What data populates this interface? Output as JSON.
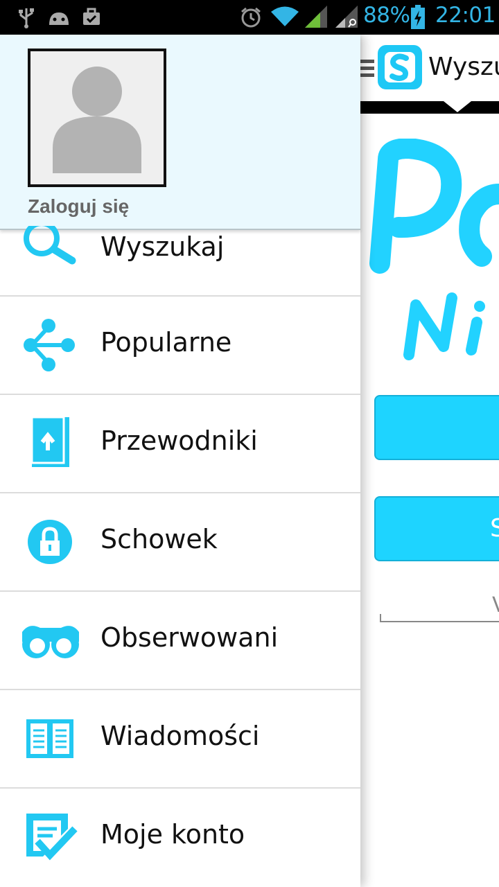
{
  "status_bar": {
    "battery": "88%",
    "time": "22:01"
  },
  "drawer": {
    "login_label": "Zaloguj się",
    "items": [
      {
        "label": "Wyszukaj",
        "icon": "search-icon"
      },
      {
        "label": "Popularne",
        "icon": "share-icon"
      },
      {
        "label": "Przewodniki",
        "icon": "book-icon"
      },
      {
        "label": "Schowek",
        "icon": "lock-icon"
      },
      {
        "label": "Obserwowani",
        "icon": "glasses-icon"
      },
      {
        "label": "Wiadomości",
        "icon": "newspaper-icon"
      },
      {
        "label": "Moje konto",
        "icon": "edit-check-icon"
      }
    ]
  },
  "app": {
    "title": "Wyszuk",
    "button2_text": "S",
    "input_text": "V",
    "accent": "#1ed4ff"
  }
}
